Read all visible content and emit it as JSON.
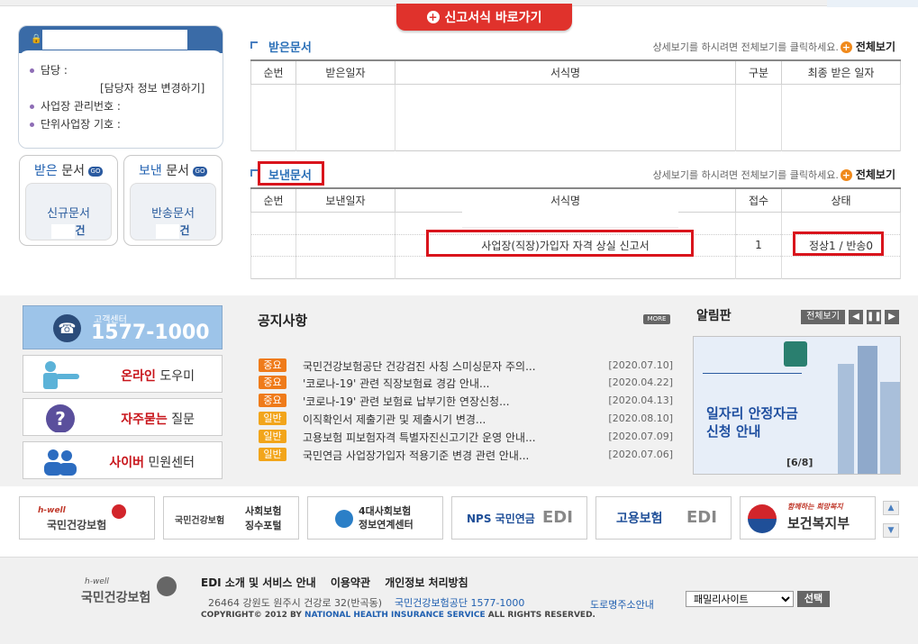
{
  "top": {
    "shortcut_label": "신고서식 바로가기"
  },
  "user": {
    "manager_label": "담당 :",
    "change_info_link": "[담당자 정보 변경하기]",
    "biz_no_label": "사업장 관리번호 :",
    "unit_no_label": "단위사업장 기호 :"
  },
  "received_box": {
    "title_a": "받은",
    "title_b": "문서",
    "go": "GO",
    "doc_label": "신규문서",
    "count_unit": "건"
  },
  "sent_box": {
    "title_a": "보낸",
    "title_b": "문서",
    "go": "GO",
    "doc_label": "반송문서",
    "count_unit": "건"
  },
  "received": {
    "title": "받은문서",
    "hint": "상세보기를 하시려면 전체보기를 클릭하세요.",
    "view_all": "전체보기",
    "columns": [
      "순번",
      "받은일자",
      "서식명",
      "구분",
      "최종 받은 일자"
    ]
  },
  "sent": {
    "title": "보낸문서",
    "hint": "상세보기를 하시려면 전체보기를 클릭하세요.",
    "view_all": "전체보기",
    "columns": [
      "순번",
      "보낸일자",
      "서식명",
      "접수",
      "상태"
    ],
    "row": {
      "form_name": "사업장(직장)가입자 자격 상실 신고서",
      "received": "1",
      "status": "정상1 / 반송0"
    }
  },
  "call_center": {
    "label": "고객센터",
    "number": "1577-1000"
  },
  "quick_links": [
    {
      "red": "온라인",
      "rest": " 도우미"
    },
    {
      "red": "자주묻는",
      "rest": " 질문"
    },
    {
      "red": "사이버",
      "rest": " 민원센터"
    }
  ],
  "notice": {
    "title": "공지사항",
    "more": "MORE",
    "items": [
      {
        "tag": "중요",
        "text": "국민건강보험공단 건강검진 사칭 스미싱문자 주의...",
        "date": "[2020.07.10]"
      },
      {
        "tag": "중요",
        "text": "'코로나-19' 관련 직장보험료 경감 안내...",
        "date": "[2020.04.22]"
      },
      {
        "tag": "중요",
        "text": "'코로나-19' 관련 보험료 납부기한 연장신청...",
        "date": "[2020.04.13]"
      },
      {
        "tag": "일반",
        "text": "이직확인서 제출기관 및 제출시기 변경...",
        "date": "[2020.08.10]"
      },
      {
        "tag": "일반",
        "text": "고용보험 피보험자격 특별자진신고기간 운영 안내...",
        "date": "[2020.07.09]"
      },
      {
        "tag": "일반",
        "text": "국민연금 사업장가입자 적용기준 변경 관련 안내...",
        "date": "[2020.07.06]"
      }
    ]
  },
  "alarm": {
    "title": "알림판",
    "view_all": "전체보기",
    "banner_line1": "일자리 안정자금",
    "banner_line2": "신청 안내",
    "page": "[6/8]"
  },
  "logos": [
    {
      "a": "h-well",
      "b": "국민건강보험"
    },
    {
      "a": "국민건강보험",
      "b": "사회보험 징수포털"
    },
    {
      "a": "4대사회보험",
      "b": "정보연계센터"
    },
    {
      "a": "NPS 국민연금",
      "b": "EDI"
    },
    {
      "a": "고용보험",
      "b": "EDI"
    },
    {
      "a": "함께하는 희망복지",
      "b": "보건복지부"
    }
  ],
  "footer": {
    "links": [
      "EDI 소개 및 서비스 안내",
      "이용약관",
      "개인정보 처리방침"
    ],
    "address": "26464  강원도 원주시 건강로 32(반곡동)",
    "org": "국민건강보험공단 1577-1000",
    "road_addr": "도로명주소안내",
    "copy_a": "COPYRIGHT© 2012 BY ",
    "copy_b": "NATIONAL HEALTH INSURANCE SERVICE",
    "copy_c": " ALL RIGHTS RESERVED.",
    "family_site": "패밀리사이트",
    "select_btn": "선택",
    "logo_small": "h-well",
    "logo_big": "국민건강보험"
  },
  "colors": {
    "brand_blue": "#3a6ba7",
    "red": "#e0322c",
    "tag_important": "#ef7b1a",
    "tag_general": "#f2a51b"
  }
}
